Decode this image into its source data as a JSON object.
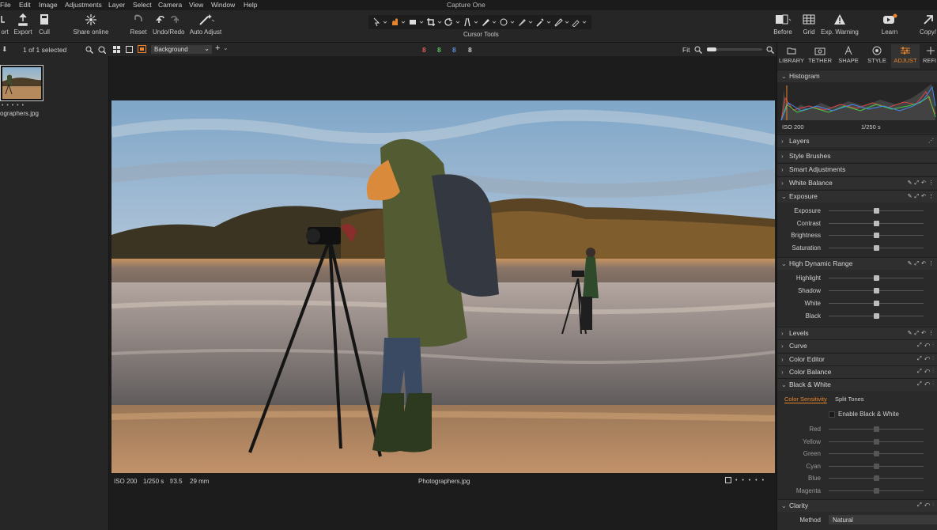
{
  "app_title": "Capture One",
  "menu": [
    "File",
    "Edit",
    "Image",
    "Adjustments",
    "Layer",
    "Select",
    "Camera",
    "View",
    "Window",
    "Help"
  ],
  "toolbar": {
    "export_left": "ort",
    "export": "Export",
    "cull": "Cull",
    "share_online": "Share online",
    "reset": "Reset",
    "undo_redo": "Undo/Redo",
    "auto_adjust": "Auto Adjust",
    "cursor_tools": "Cursor Tools",
    "before": "Before",
    "grid": "Grid",
    "exp_warning": "Exp. Warning",
    "learn": "Learn",
    "copy": "Copy/"
  },
  "browser": {
    "selected_text": "1 of 1 selected",
    "layer_select": "Background",
    "thumb_filename": "ographers.jpg",
    "thumb_dots": "• • • • •"
  },
  "viewer": {
    "rating_counts": [
      "8",
      "8",
      "8",
      "8"
    ],
    "rating_colors": [
      "#e05a5a",
      "#5ac35a",
      "#5a8de0",
      "#d0d0d0"
    ],
    "zoom_label": "Fit",
    "status": {
      "iso": "ISO 200",
      "shutter": "1/250 s",
      "aperture": "f/3.5",
      "focal": "29 mm",
      "filename": "Photographers.jpg",
      "dots": "• • • • •"
    }
  },
  "panel": {
    "tabs": [
      "LIBRARY",
      "TETHER",
      "SHAPE",
      "STYLE",
      "ADJUST",
      "REFI"
    ],
    "active_tab": "ADJUST",
    "accent": "#e8852a",
    "histogram": {
      "title": "Histogram",
      "iso": "ISO 200",
      "shutter": "1/250 s"
    },
    "sections": {
      "layers": "Layers",
      "style_brushes": "Style Brushes",
      "smart_adjustments": "Smart Adjustments",
      "white_balance": "White Balance",
      "exposure": "Exposure",
      "hdr": "High Dynamic Range",
      "levels": "Levels",
      "curve": "Curve",
      "color_editor": "Color Editor",
      "color_balance": "Color Balance",
      "black_white": "Black & White",
      "clarity": "Clarity"
    },
    "exposure_sliders": [
      {
        "label": "Exposure",
        "value": 0.5
      },
      {
        "label": "Contrast",
        "value": 0.5
      },
      {
        "label": "Brightness",
        "value": 0.5
      },
      {
        "label": "Saturation",
        "value": 0.5
      }
    ],
    "hdr_sliders": [
      {
        "label": "Highlight",
        "value": 0.5
      },
      {
        "label": "Shadow",
        "value": 0.5
      },
      {
        "label": "White",
        "value": 0.5
      },
      {
        "label": "Black",
        "value": 0.5
      }
    ],
    "bw": {
      "tab_active": "Color Sensitivity",
      "tab_other": "Split Tones",
      "enable_label": "Enable Black & White",
      "sliders": [
        {
          "label": "Red",
          "value": 0.5
        },
        {
          "label": "Yellow",
          "value": 0.5
        },
        {
          "label": "Green",
          "value": 0.5
        },
        {
          "label": "Cyan",
          "value": 0.5
        },
        {
          "label": "Blue",
          "value": 0.5
        },
        {
          "label": "Magenta",
          "value": 0.5
        }
      ]
    },
    "clarity": {
      "method_label": "Method",
      "method_value": "Natural"
    }
  }
}
